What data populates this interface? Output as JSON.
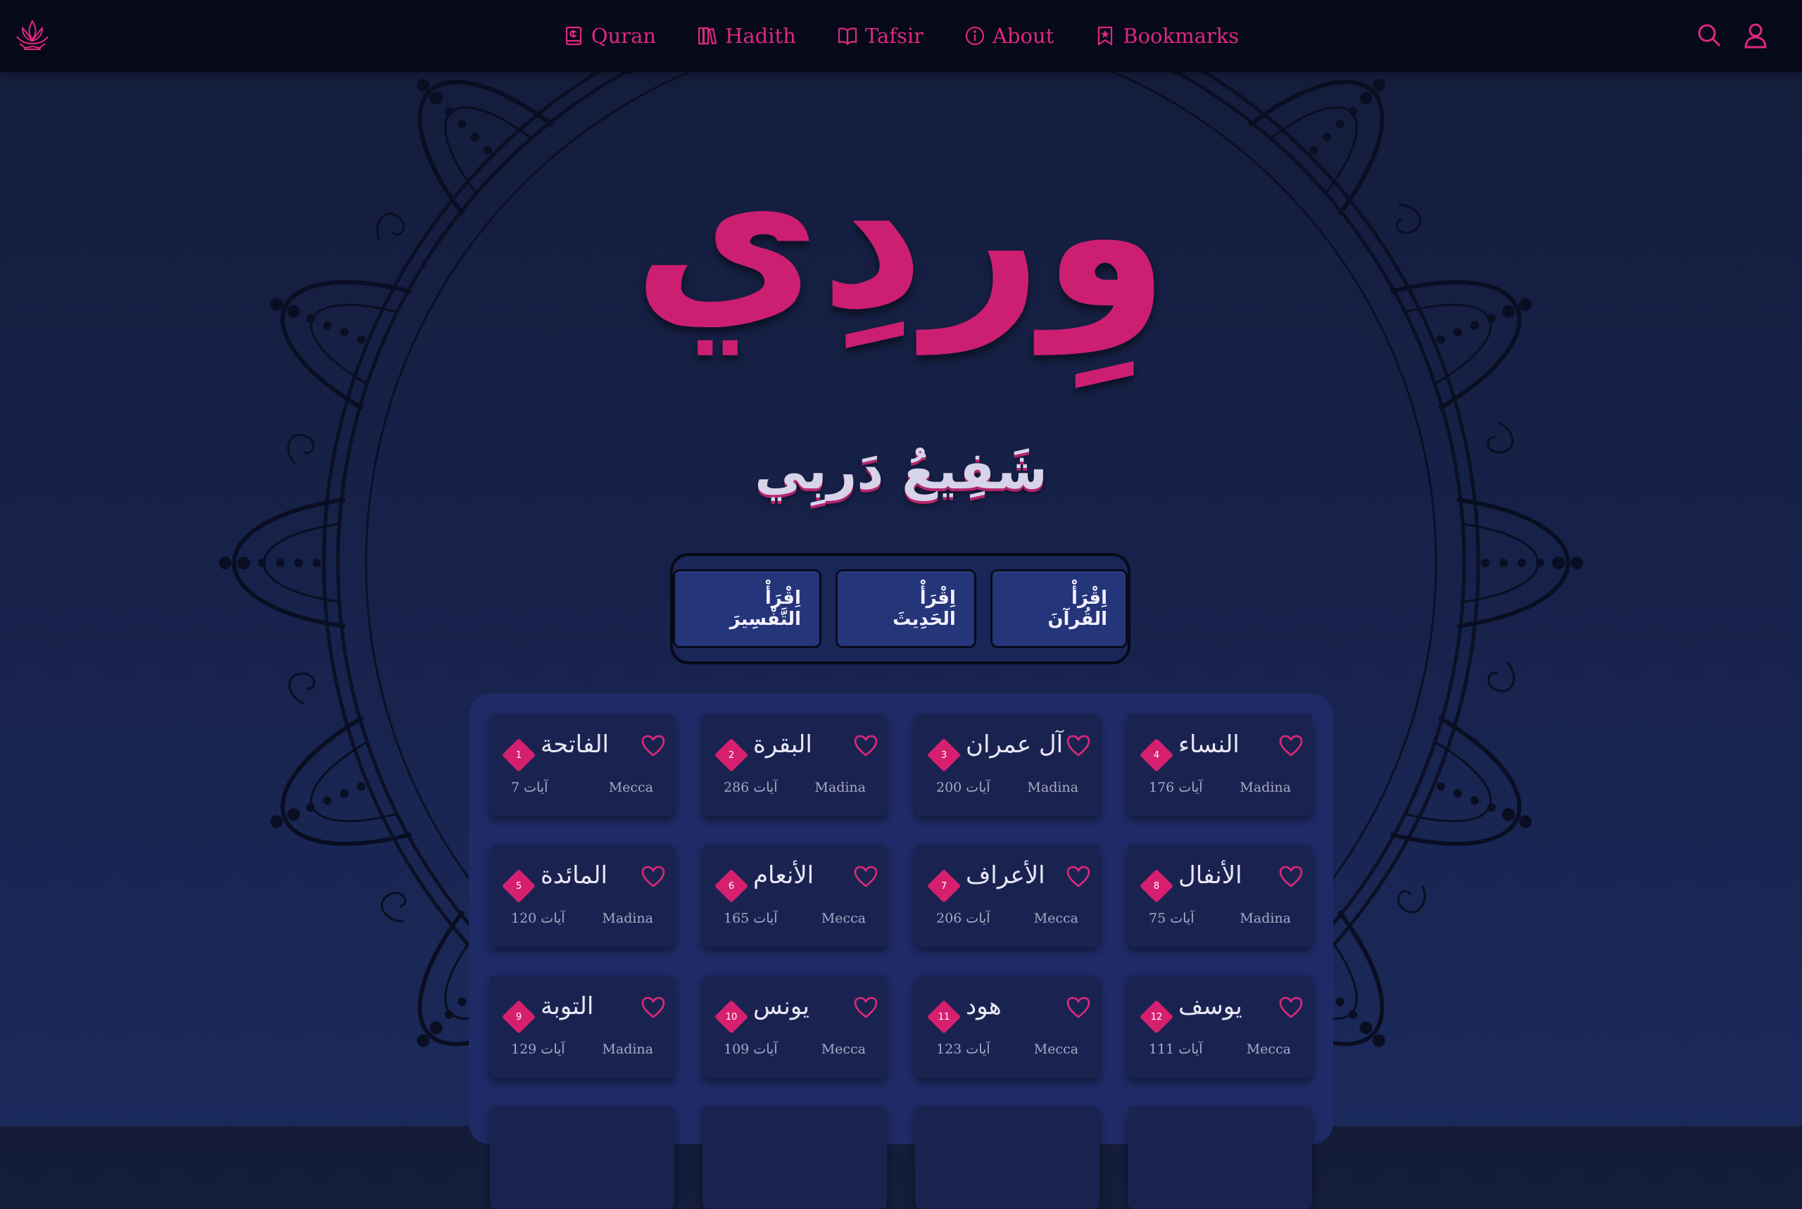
{
  "nav": {
    "items": [
      {
        "label": "Quran",
        "icon": "quran-book-icon"
      },
      {
        "label": "Hadith",
        "icon": "books-icon"
      },
      {
        "label": "Tafsir",
        "icon": "open-book-icon"
      },
      {
        "label": "About",
        "icon": "info-icon"
      },
      {
        "label": "Bookmarks",
        "icon": "bookmark-icon"
      }
    ],
    "search_icon": "search-icon",
    "user_icon": "user-icon"
  },
  "hero": {
    "title": "وِردِي",
    "subtitle": "شَفِيعُ دَربِي"
  },
  "actions": {
    "read_tafsir": "اِقْرَأْ التَّفْسِيرَ",
    "read_hadith": "اِقْرَأْ الحَدِيثَ",
    "read_quran": "اِقْرَأْ القُرآنَ"
  },
  "surahs": [
    {
      "number": "1",
      "name": "الفاتحة",
      "ayat": "آيات 7",
      "place": "Mecca"
    },
    {
      "number": "2",
      "name": "البقرة",
      "ayat": "آيات 286",
      "place": "Madina"
    },
    {
      "number": "3",
      "name": "آل عمران",
      "ayat": "آيات 200",
      "place": "Madina"
    },
    {
      "number": "4",
      "name": "النساء",
      "ayat": "آيات 176",
      "place": "Madina"
    },
    {
      "number": "5",
      "name": "المائدة",
      "ayat": "آيات 120",
      "place": "Madina"
    },
    {
      "number": "6",
      "name": "الأنعام",
      "ayat": "آيات 165",
      "place": "Mecca"
    },
    {
      "number": "7",
      "name": "الأعراف",
      "ayat": "آيات 206",
      "place": "Mecca"
    },
    {
      "number": "8",
      "name": "الأنفال",
      "ayat": "آيات 75",
      "place": "Madina"
    },
    {
      "number": "9",
      "name": "التوبة",
      "ayat": "آيات 129",
      "place": "Madina"
    },
    {
      "number": "10",
      "name": "يونس",
      "ayat": "آيات 109",
      "place": "Mecca"
    },
    {
      "number": "11",
      "name": "هود",
      "ayat": "آيات 123",
      "place": "Mecca"
    },
    {
      "number": "12",
      "name": "يوسف",
      "ayat": "آيات 111",
      "place": "Mecca"
    }
  ],
  "colors": {
    "accent": "#e0287a",
    "background": "#17224a",
    "topbar": "#05091a",
    "card": "#1a2350"
  }
}
